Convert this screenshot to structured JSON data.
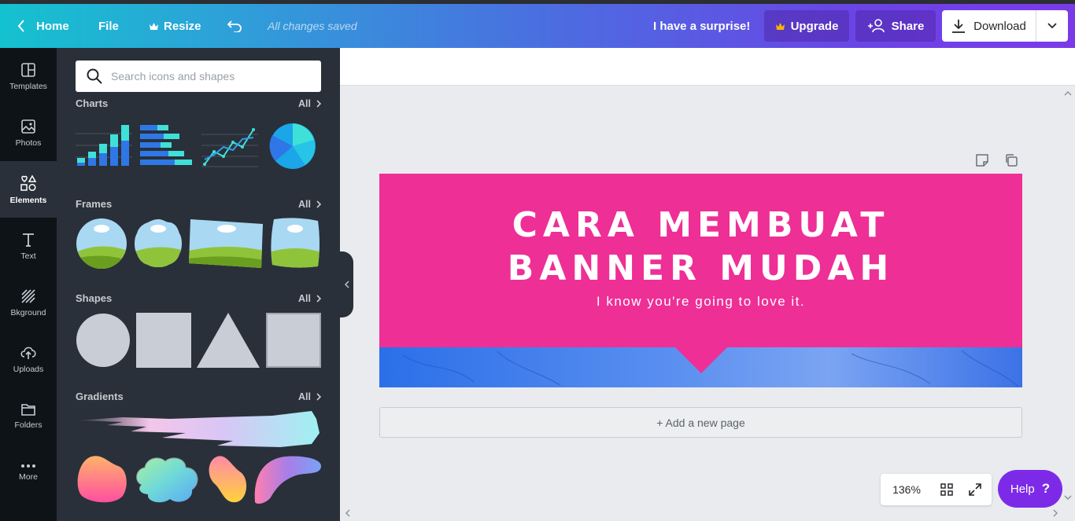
{
  "topbar": {
    "home_label": "Home",
    "file_label": "File",
    "resize_label": "Resize",
    "saved_status": "All changes saved",
    "surprise_label": "I have a surprise!",
    "upgrade_label": "Upgrade",
    "share_label": "Share",
    "download_label": "Download"
  },
  "leftnav": {
    "items": [
      {
        "label": "Templates",
        "icon": "templates-icon"
      },
      {
        "label": "Photos",
        "icon": "photos-icon"
      },
      {
        "label": "Elements",
        "icon": "elements-icon",
        "active": true
      },
      {
        "label": "Text",
        "icon": "text-icon"
      },
      {
        "label": "Bkground",
        "icon": "background-icon"
      },
      {
        "label": "Uploads",
        "icon": "uploads-icon"
      },
      {
        "label": "Folders",
        "icon": "folders-icon"
      },
      {
        "label": "More",
        "icon": "more-icon"
      }
    ]
  },
  "panel": {
    "search_placeholder": "Search icons and shapes",
    "sections": [
      {
        "title": "Charts",
        "all_label": "All"
      },
      {
        "title": "Frames",
        "all_label": "All"
      },
      {
        "title": "Shapes",
        "all_label": "All"
      },
      {
        "title": "Gradients",
        "all_label": "All"
      }
    ]
  },
  "design": {
    "title_line1": "CARA MEMBUAT",
    "title_line2": "BANNER MUDAH",
    "subtitle": "I know you're going to love it.",
    "add_page_label": "+ Add a new page"
  },
  "footer": {
    "zoom": "136%",
    "help_label": "Help",
    "help_glyph": "?"
  },
  "colors": {
    "banner_pink": "#ee2f96",
    "accent_purple": "#7d2ae8",
    "topbar_start": "#14c2cf",
    "topbar_end": "#7b3ae8"
  }
}
